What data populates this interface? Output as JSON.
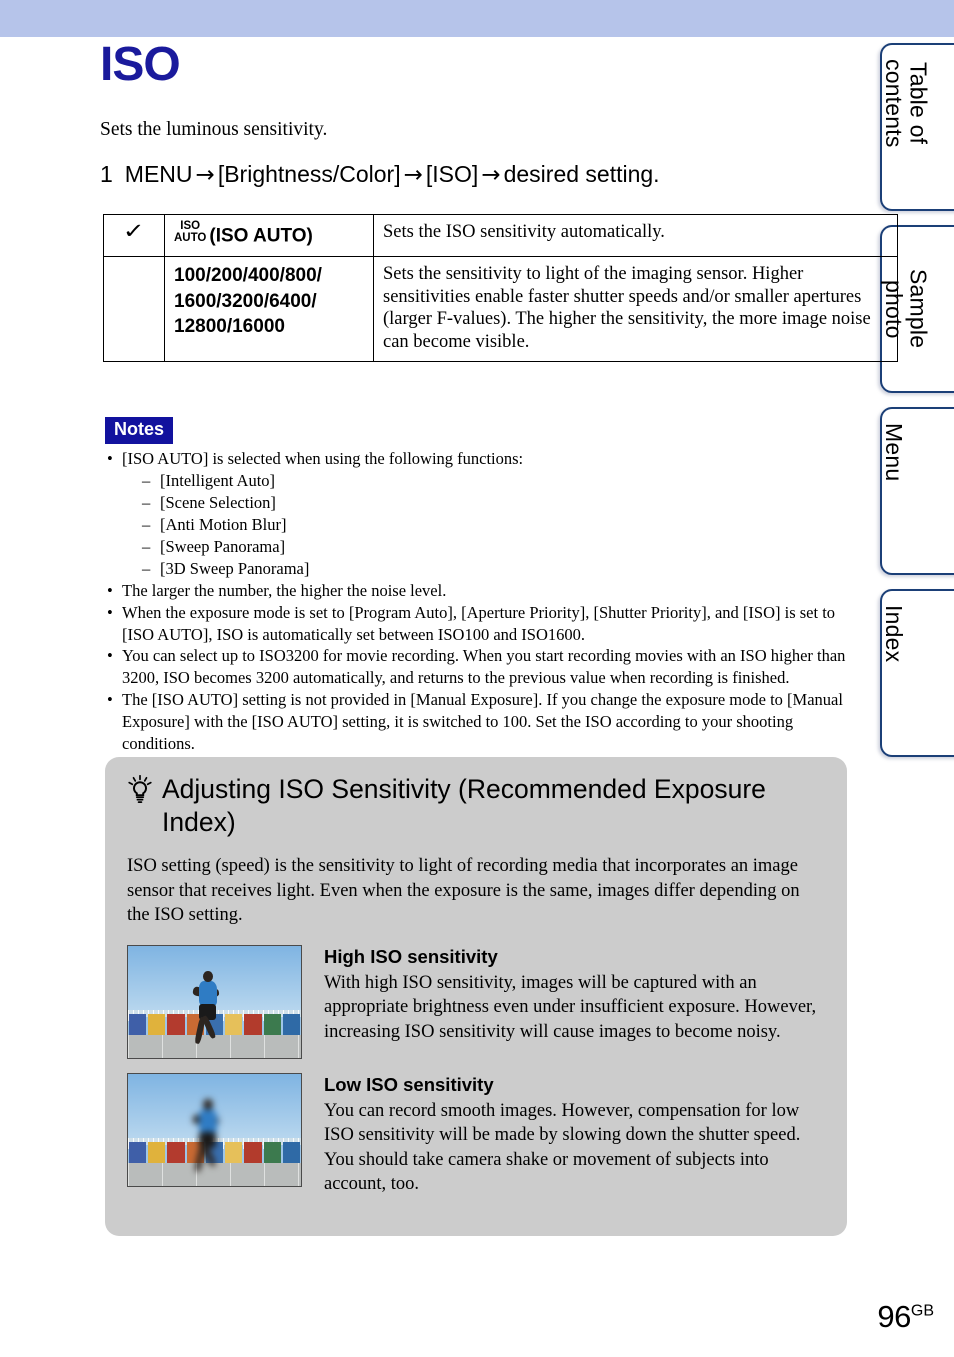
{
  "header": {
    "bar_color": "#b6c4ea"
  },
  "side_tabs": [
    {
      "label": "Table of\ncontents",
      "name": "table-of-contents"
    },
    {
      "label": "Sample photo",
      "name": "sample-photo"
    },
    {
      "label": "Menu",
      "name": "menu"
    },
    {
      "label": "Index",
      "name": "index"
    }
  ],
  "page": {
    "title": "ISO",
    "title_color": "#1a1a9c",
    "lead": "Sets the luminous sensitivity.",
    "number": "96",
    "number_suffix": "GB"
  },
  "step": {
    "num": "1",
    "menu": "MENU",
    "arrow1": "→",
    "item1": "[Brightness/Color]",
    "arrow2": "→",
    "item2": "[ISO]",
    "arrow3": "→",
    "tail": "desired setting."
  },
  "table": {
    "rows": [
      {
        "checked": "✓",
        "icon_line1": "ISO",
        "icon_line2": "AUTO",
        "name": "(ISO AUTO)",
        "description": "Sets the ISO sensitivity automatically."
      },
      {
        "checked": "",
        "icon_line1": "",
        "icon_line2": "",
        "name": "100/200/400/800/\n1600/3200/6400/\n12800/16000",
        "description": "Sets the sensitivity to light of the imaging sensor. Higher sensitivities enable faster  shutter speeds and/or smaller apertures (larger F-values). The higher the sensitivity, the more image noise can become visible."
      }
    ]
  },
  "notes": {
    "badge": "Notes",
    "badge_bg": "#12129e",
    "items": [
      "[ISO AUTO] is selected when using the following functions:",
      "The larger the number, the higher the noise level.",
      "When the exposure mode is set to [Program Auto], [Aperture Priority], [Shutter Priority], and [ISO] is set to [ISO AUTO], ISO is automatically set between ISO100 and ISO1600.",
      "You can select up to ISO3200 for movie recording. When you start recording movies with an ISO higher than 3200, ISO becomes 3200 automatically, and returns to the previous value when recording is finished.",
      "The [ISO AUTO] setting is not provided in [Manual Exposure]. If you change the exposure mode to [Manual Exposure] with the [ISO AUTO] setting, it is switched to 100. Set the ISO according to your shooting conditions."
    ],
    "sub_items": [
      "[Intelligent Auto]",
      "[Scene Selection]",
      "[Anti Motion Blur]",
      "[Sweep Panorama]",
      "[3D Sweep Panorama]"
    ]
  },
  "tip": {
    "bg_color": "#cccccc",
    "title": "Adjusting ISO Sensitivity (Recommended Exposure Index)",
    "intro": "ISO setting (speed) is the sensitivity to light of recording media that incorporates an image sensor that receives light. Even when the exposure is the same, images differ depending on the ISO setting.",
    "blocks": [
      {
        "heading": "High ISO sensitivity",
        "body": "With high ISO sensitivity, images will be captured with an appropriate brightness even under insufficient exposure. However, increasing ISO sensitivity will cause images to become noisy."
      },
      {
        "heading": "Low ISO sensitivity",
        "body": "You can record smooth images. However, compensation for low ISO sensitivity will be made by slowing down the shutter speed. You should take camera shake or movement of subjects into account, too."
      }
    ],
    "hut_colors": [
      "#3f5fa8",
      "#e0b23c",
      "#b33b2e",
      "#c96a33",
      "#3a6fae",
      "#e6c05a",
      "#b23b2c",
      "#3c7a4e",
      "#2f6aa6"
    ]
  }
}
